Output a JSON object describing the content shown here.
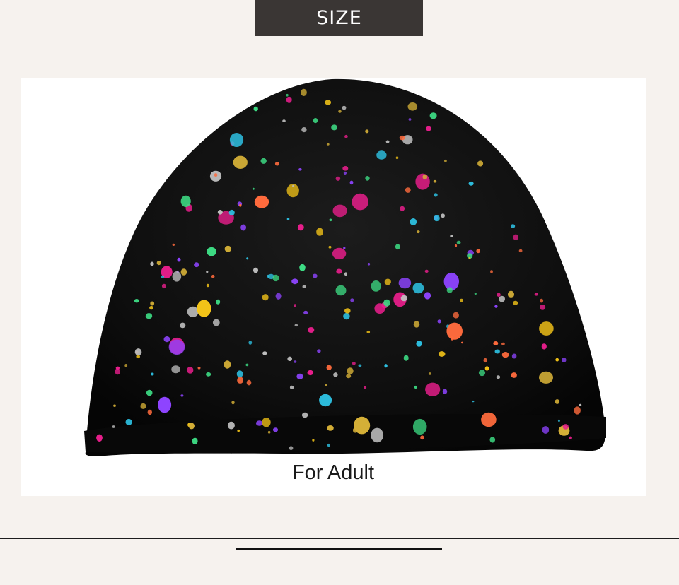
{
  "header": {
    "title": "SIZE"
  },
  "product": {
    "caption": "For Adult",
    "hat_color": "#0f0f0f",
    "splatter_colors": [
      "#e91e8c",
      "#2ec4e6",
      "#f5c518",
      "#8e44ff",
      "#3ddc84",
      "#ff6b3d",
      "#d4af37",
      "#c0c0c0"
    ]
  },
  "colors": {
    "page_background": "#f6f2ee",
    "banner_background": "#3a3634",
    "panel_background": "#ffffff"
  }
}
